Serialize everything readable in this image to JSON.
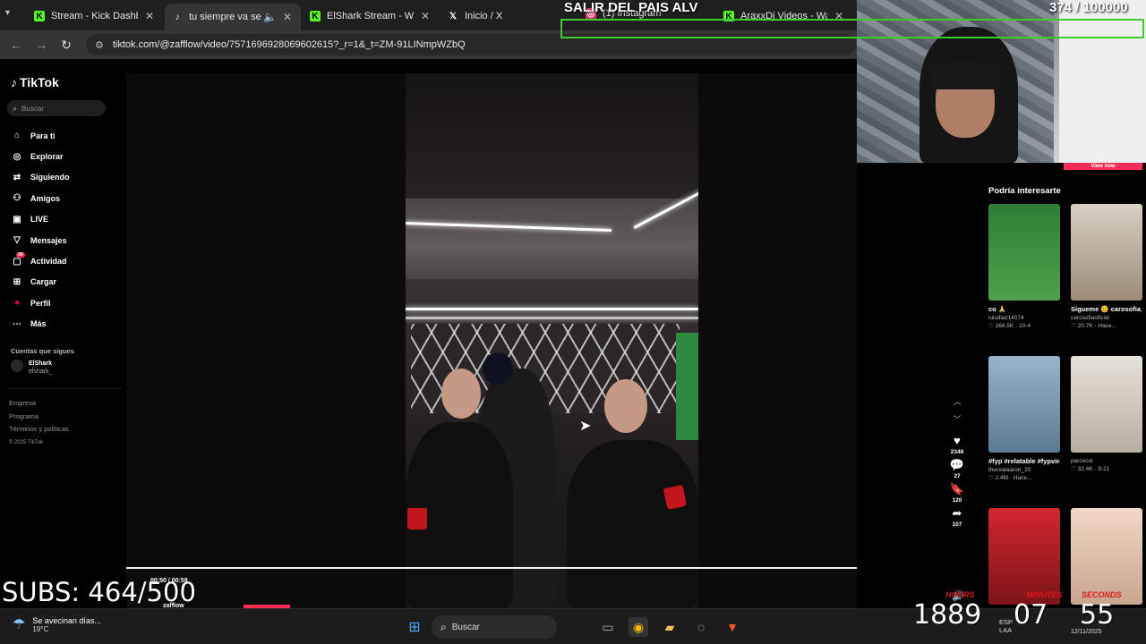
{
  "browser": {
    "tabs": [
      {
        "label": "Stream - Kick Dashboa",
        "favicon": "kick-icon",
        "color": "#53fc18"
      },
      {
        "label": "tu siempre va ser m",
        "favicon": "tiktok-icon",
        "color": "#ffffff"
      },
      {
        "label": "ElShark Stream - Watc",
        "favicon": "kick-icon",
        "color": "#53fc18"
      },
      {
        "label": "Inicio / X",
        "favicon": "x-icon",
        "color": "#ffffff"
      },
      {
        "label": "(1) Instagram",
        "favicon": "instagram-icon",
        "color": "#e1306c"
      },
      {
        "label": "AraxxDj Videos - Watc",
        "favicon": "kick-icon",
        "color": "#53fc18"
      }
    ],
    "url": "tiktok.com/@zafflow/video/7571696928069602615?_r=1&_t=ZM-91LINmpWZbQ"
  },
  "tiktok": {
    "logo": "TikTok",
    "search_placeholder": "Buscar",
    "nav": [
      {
        "label": "Para ti",
        "icon": "home-icon"
      },
      {
        "label": "Explorar",
        "icon": "compass-icon"
      },
      {
        "label": "Siguiendo",
        "icon": "following-icon"
      },
      {
        "label": "Amigos",
        "icon": "friends-icon"
      },
      {
        "label": "LIVE",
        "icon": "live-icon"
      },
      {
        "label": "Mensajes",
        "icon": "messages-icon"
      },
      {
        "label": "Actividad",
        "icon": "activity-icon",
        "badge": "30"
      },
      {
        "label": "Cargar",
        "icon": "upload-icon"
      },
      {
        "label": "Perfil",
        "icon": "profile-icon"
      },
      {
        "label": "Más",
        "icon": "more-icon"
      }
    ],
    "following_title": "Cuentas que sigues",
    "following": [
      {
        "name": "ElShark",
        "handle": "elshark_"
      }
    ],
    "footer": [
      "Empresa",
      "Programa",
      "Términos y políticas"
    ],
    "copyright": "© 2025 TikTok",
    "video": {
      "time": "00:50 / 00:59",
      "author": "zafflow",
      "progress": 1.0
    },
    "actions": [
      {
        "icon": "heart-icon",
        "count": "2348"
      },
      {
        "icon": "comment-icon",
        "count": "27"
      },
      {
        "icon": "bookmark-icon",
        "count": "120"
      },
      {
        "icon": "share-icon",
        "count": "107"
      }
    ],
    "view_now": "View now",
    "recommendations_title": "Podría interesarte",
    "recommendations": [
      {
        "caption": "co 🙏",
        "author": "luisdiaz14074",
        "stats": "♡ 266.5K · 10-4",
        "color": "#3c8a3a"
      },
      {
        "caption": "Sígueme 😊 carosofia__",
        "author": "carosofiaoficial",
        "stats": "♡ 20.7K · Hace...",
        "color": "#c9b59a"
      },
      {
        "caption": "#fyp #relatable #fypviral #viral",
        "author": "therealaaron_20",
        "stats": "♡ 2.4M · Hace...",
        "color": "#6e8ea8"
      },
      {
        "caption": "",
        "author": "parcecol",
        "stats": "♡ 32.4K · 9-21",
        "color": "#d9d4cc"
      },
      {
        "caption": "",
        "author": "",
        "stats": "",
        "color": "#d4262e"
      },
      {
        "caption": "",
        "author": "",
        "stats": "",
        "color": "#e7c9b8"
      }
    ]
  },
  "overlay": {
    "title_text": "SALIR DEL PAIS ALV",
    "goal_counter": "374 / 100000",
    "subs": "SUBS: 464/500",
    "timer": {
      "hours_label": "HOURS",
      "minutes_label": "MINUTES",
      "seconds_label": "SECONDS",
      "hours": "1889",
      "minutes": "07",
      "seconds": "55"
    }
  },
  "taskbar": {
    "weather_text": "Se avecinan días...",
    "temperature": "19°C",
    "search_label": "Buscar",
    "language": "ESP",
    "language_sub": "LAA",
    "date": "12/11/2025"
  }
}
